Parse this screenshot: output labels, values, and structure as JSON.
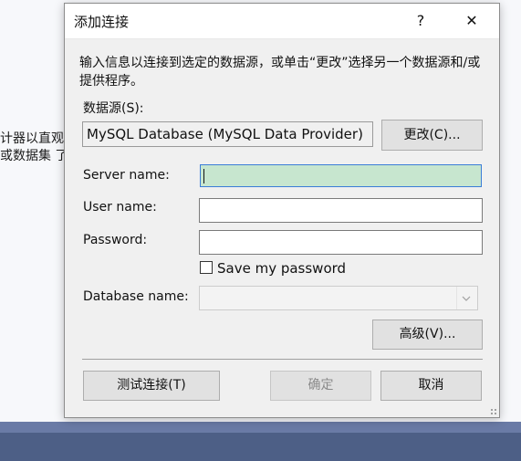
{
  "background": {
    "line1": "计器以直观方",
    "line2_prefix": "或数据集",
    "line2_link": "了"
  },
  "dialog": {
    "title": "添加连接",
    "help_icon": "?",
    "close_icon": "✕",
    "description": "输入信息以连接到选定的数据源，或单击“更改”选择另一个数据源和/或提供程序。",
    "data_source_label": "数据源(S):",
    "data_source_value": "MySQL Database (MySQL Data Provider)",
    "change_button": "更改(C)...",
    "server_name_label": "Server name:",
    "server_name_value": "",
    "user_name_label": "User name:",
    "user_name_value": "",
    "password_label": "Password:",
    "password_value": "",
    "save_password_label": "Save my password",
    "save_password_checked": false,
    "database_name_label": "Database name:",
    "database_name_value": "",
    "database_dropdown_icon": "chevron-down",
    "advanced_button": "高级(V)...",
    "test_button": "测试连接(T)",
    "ok_button": "确定",
    "cancel_button": "取消"
  },
  "colors": {
    "server_field_bg": "#c7e6cf",
    "focus_border": "#3b7dd8",
    "taskbar_top": "#6a7ba6",
    "taskbar_bottom": "#4d5f86"
  }
}
